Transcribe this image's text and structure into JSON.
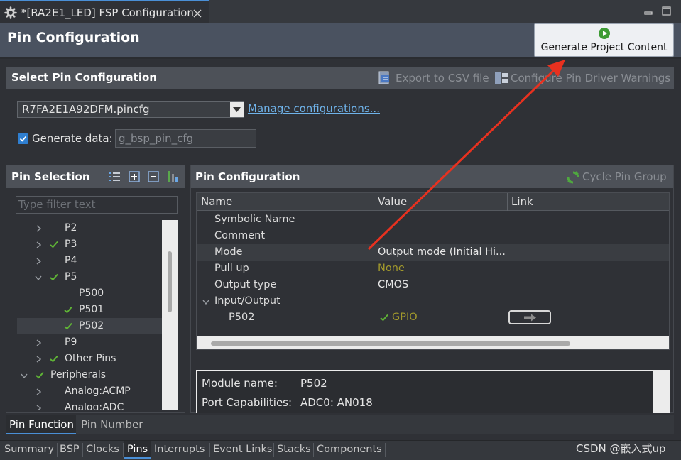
{
  "editor_tab": {
    "title": "*[RA2E1_LED] FSP Configuration"
  },
  "header": {
    "title": "Pin Configuration",
    "generate_button": "Generate Project Content"
  },
  "select_section": {
    "title": "Select Pin Configuration",
    "export_csv": "Export to CSV file",
    "configure_warnings": "Configure Pin Driver Warnings",
    "config_file": "R7FA2E1A92DFM.pincfg",
    "manage_link": "Manage configurations...",
    "generate_data_label": "Generate data:",
    "generate_data_value": "g_bsp_pin_cfg",
    "generate_data_checked": true
  },
  "pin_selection": {
    "title": "Pin Selection",
    "filter_placeholder": "Type filter text",
    "tree": [
      {
        "label": "P2"
      },
      {
        "label": "P3"
      },
      {
        "label": "P4"
      },
      {
        "label": "P5"
      },
      {
        "label": "P500"
      },
      {
        "label": "P501"
      },
      {
        "label": "P502"
      },
      {
        "label": "P9"
      },
      {
        "label": "Other Pins"
      },
      {
        "label": "Peripherals"
      },
      {
        "label": "Analog:ACMP"
      },
      {
        "label": "Analog:ADC"
      }
    ]
  },
  "pin_config": {
    "title": "Pin Configuration",
    "cycle_group": "Cycle Pin Group",
    "columns": [
      "Name",
      "Value",
      "Link"
    ],
    "rows": [
      {
        "name": "Symbolic Name",
        "value": ""
      },
      {
        "name": "Comment",
        "value": ""
      },
      {
        "name": "Mode",
        "value": "Output mode (Initial Hi..."
      },
      {
        "name": "Pull up",
        "value": "None"
      },
      {
        "name": "Output type",
        "value": "CMOS"
      },
      {
        "name": "Input/Output",
        "value": ""
      },
      {
        "name": "P502",
        "value": "GPIO"
      }
    ]
  },
  "details": {
    "module_label": "Module name:",
    "module_value": "P502",
    "capabilities_label": "Port Capabilities:",
    "capabilities_value": "ADC0: AN018"
  },
  "view_tabs": [
    "Pin Function",
    "Pin Number"
  ],
  "bottom_tabs": [
    "Summary",
    "BSP",
    "Clocks",
    "Pins",
    "Interrupts",
    "Event Links",
    "Stacks",
    "Components"
  ],
  "watermark": "CSDN @嵌入式up",
  "colors": {
    "accent": "#4a8fd6",
    "check": "#5fb336",
    "gold": "#a39a2c",
    "link": "#6fb3ea",
    "arrow": "#e8311f"
  }
}
